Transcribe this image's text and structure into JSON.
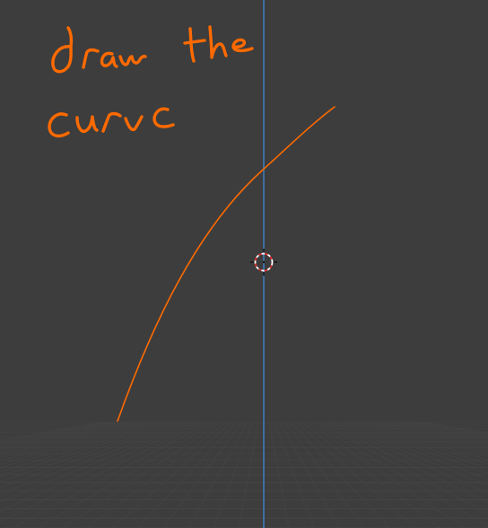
{
  "viewport": {
    "background_color": "#3d3d3d",
    "grid_color": "#474747",
    "z_axis_color": "#3f7fbf"
  },
  "annotation": {
    "text": "draw the curve",
    "color": "#ff6a00"
  },
  "curve": {
    "color": "#ff6a00"
  },
  "cursor_3d": {
    "icon": "3d-cursor-icon",
    "ring_color_a": "#ffffff",
    "ring_color_b": "#e03030"
  }
}
